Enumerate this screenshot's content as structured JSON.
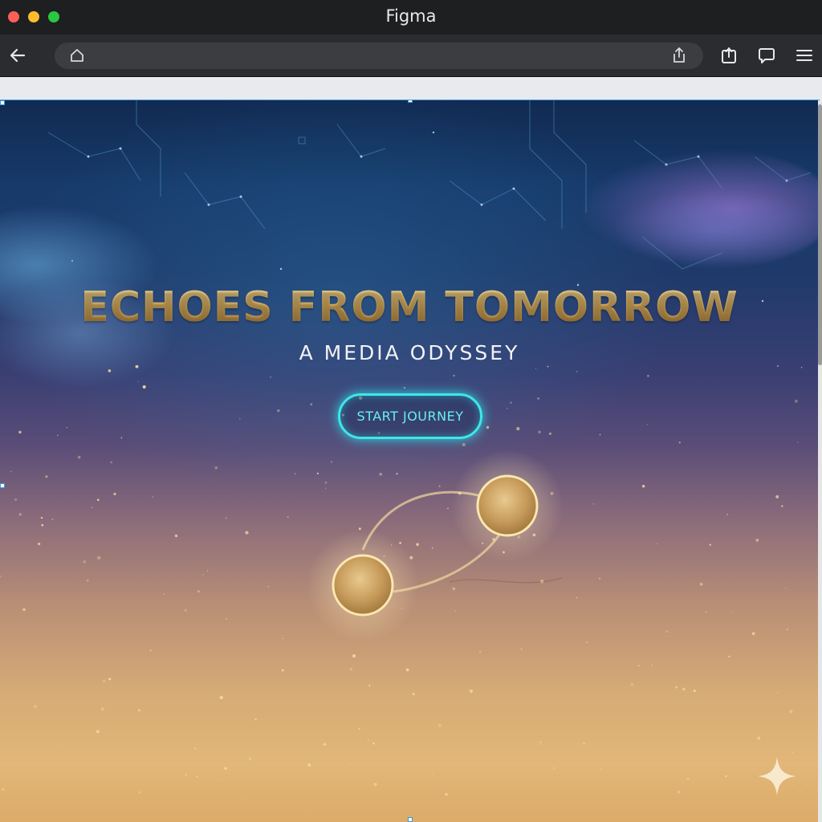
{
  "window": {
    "title": "Figma"
  },
  "toolbar": {
    "back_icon": "arrow-left-icon",
    "home_icon": "home-icon",
    "share_icon": "share-icon",
    "icons": [
      "share-box-icon",
      "chat-bubble-icon",
      "hamburger-menu-icon"
    ]
  },
  "hero": {
    "title": "ECHOES FROM TOMORROW",
    "subtitle": "A MEDIA ODYSSEY",
    "cta_label": "START JOURNEY"
  },
  "colors": {
    "accent": "#3fe6ea",
    "title_gold": "#d9b36a",
    "sky_top": "#112a52",
    "sand_bottom": "#dcab6a"
  }
}
